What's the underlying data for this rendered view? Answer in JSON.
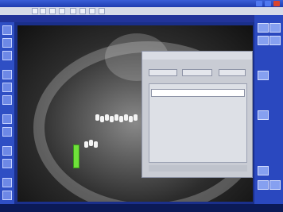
{
  "window": {
    "title": ""
  },
  "dialog": {
    "title": "",
    "tabs": [
      "",
      "",
      ""
    ],
    "row": ""
  }
}
